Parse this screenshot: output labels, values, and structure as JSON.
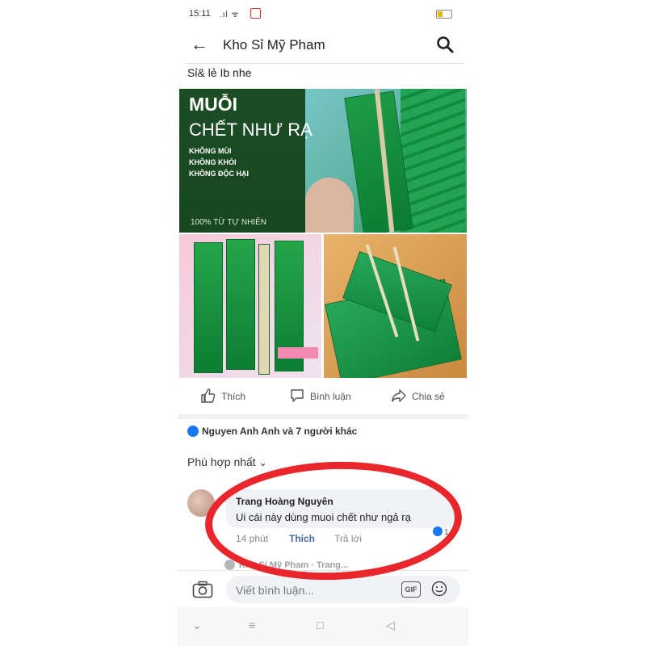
{
  "status": {
    "time": "15:11"
  },
  "header": {
    "title": "Kho Sỉ Mỹ Pham"
  },
  "post": {
    "text": "Sỉ& lẻ Ib nhe",
    "image_text": {
      "line1": "MUỖI",
      "line2": "CHẾT NHƯ RẠ",
      "features": [
        "KHÔNG MÙI",
        "KHÔNG KHÓI",
        "KHÔNG ĐỘC HẠI"
      ],
      "natural": "100% TỪ TỰ NHIÊN"
    }
  },
  "actions": {
    "like": "Thích",
    "comment": "Bình luận",
    "share": "Chia sẻ"
  },
  "reactions": {
    "summary": "Nguyen Anh Anh và 7 người khác"
  },
  "sort": {
    "label": "Phù hợp nhất"
  },
  "comment": {
    "author": "Trang Hoàng Nguyên",
    "text": "Ui cái này dùng muoi chết như ngả rạ",
    "time": "14 phút",
    "like": "Thích",
    "reply": "Trả lời",
    "reaction_count": "1"
  },
  "reply_preview": {
    "text": "Kho Sỉ Mỹ Pham · Trang..."
  },
  "input": {
    "placeholder": "Viết bình luận...",
    "gif": "GIF"
  },
  "colors": {
    "accent": "#1877f2",
    "highlight_ring": "#e8262c",
    "product_green": "#1d4d25"
  }
}
